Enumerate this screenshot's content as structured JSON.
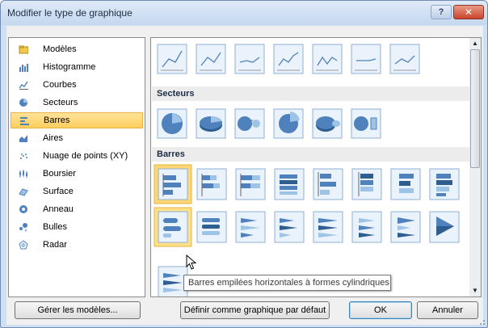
{
  "window": {
    "title": "Modifier le type de graphique",
    "help_label": "?",
    "close_label": "✕"
  },
  "categories": [
    {
      "label": "Modèles",
      "icon": "folder-icon"
    },
    {
      "label": "Histogramme",
      "icon": "column-chart-icon"
    },
    {
      "label": "Courbes",
      "icon": "line-chart-icon"
    },
    {
      "label": "Secteurs",
      "icon": "pie-chart-icon"
    },
    {
      "label": "Barres",
      "icon": "bar-chart-icon",
      "selected": true
    },
    {
      "label": "Aires",
      "icon": "area-chart-icon"
    },
    {
      "label": "Nuage de points (XY)",
      "icon": "scatter-chart-icon"
    },
    {
      "label": "Boursier",
      "icon": "stock-chart-icon"
    },
    {
      "label": "Surface",
      "icon": "surface-chart-icon"
    },
    {
      "label": "Anneau",
      "icon": "doughnut-chart-icon"
    },
    {
      "label": "Bulles",
      "icon": "bubble-chart-icon"
    },
    {
      "label": "Radar",
      "icon": "radar-chart-icon"
    }
  ],
  "sections": {
    "secteurs": "Secteurs",
    "barres": "Barres"
  },
  "tooltip": "Barres empilées horizontales à formes cylindriques",
  "buttons": {
    "manage_templates": "Gérer les modèles...",
    "set_default": "Définir comme graphique par défaut",
    "ok": "OK",
    "cancel": "Annuler"
  },
  "colors": {
    "accent": "#ffd777",
    "chart_blue": "#4f81bd",
    "chart_light": "#9dc3e6"
  }
}
